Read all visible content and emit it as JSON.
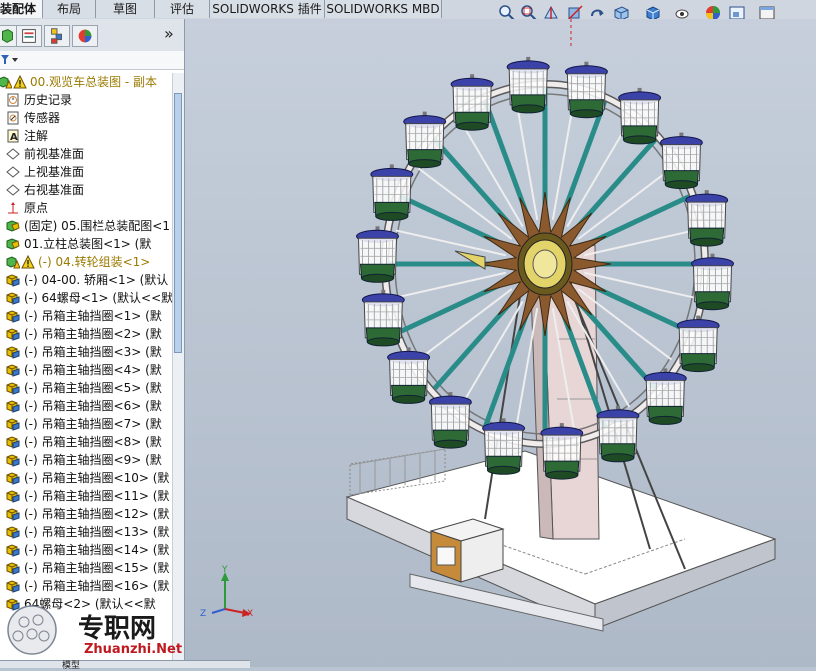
{
  "tabs": [
    {
      "label": "装配体",
      "active": true
    },
    {
      "label": "布局"
    },
    {
      "label": "草图"
    },
    {
      "label": "评估"
    },
    {
      "label": "SOLIDWORKS 插件"
    },
    {
      "label": "SOLIDWORKS MBD"
    }
  ],
  "view_toolbar_icons": [
    "zoom-to-fit-icon",
    "zoom-area-icon",
    "previous-view-icon",
    "section-view-icon",
    "dynamic-annotation-icon",
    "view-orientation-icon",
    "display-style-icon",
    "hide-show-icon",
    "appearance-icon",
    "scene-icon",
    "display-pane-icon"
  ],
  "panel": {
    "tab_icons": [
      "feature-manager-icon",
      "property-manager-icon",
      "configuration-manager-icon",
      "display-manager-icon"
    ],
    "expand_glyph": "»"
  },
  "tree": [
    {
      "label": "00.观览车总装图 - 副本",
      "icon": "assembly-warning-icon",
      "color": "#9a7a00"
    },
    {
      "label": "历史记录",
      "icon": "history-icon"
    },
    {
      "label": "传感器",
      "icon": "sensor-icon"
    },
    {
      "label": "注解",
      "icon": "annotation-icon"
    },
    {
      "label": "前视基准面",
      "icon": "plane-icon"
    },
    {
      "label": "上视基准面",
      "icon": "plane-icon"
    },
    {
      "label": "右视基准面",
      "icon": "plane-icon"
    },
    {
      "label": "原点",
      "icon": "origin-icon"
    },
    {
      "label": "(固定) 05.围栏总装配图<1",
      "icon": "subassembly-icon"
    },
    {
      "label": "01.立柱总装图<1> (默",
      "icon": "subassembly-icon"
    },
    {
      "label": "(-) 04.转轮组装<1>",
      "icon": "subassembly-warning-icon",
      "color": "#9a7a00"
    },
    {
      "label": "(-) 04-00. 轿厢<1> (默认",
      "icon": "part-icon"
    },
    {
      "label": "(-) 64螺母<1> (默认<<默",
      "icon": "part-icon"
    },
    {
      "label": "(-) 吊箱主轴挡圈<1> (默",
      "icon": "part-icon"
    },
    {
      "label": "(-) 吊箱主轴挡圈<2> (默",
      "icon": "part-icon"
    },
    {
      "label": "(-) 吊箱主轴挡圈<3> (默",
      "icon": "part-icon"
    },
    {
      "label": "(-) 吊箱主轴挡圈<4> (默",
      "icon": "part-icon"
    },
    {
      "label": "(-) 吊箱主轴挡圈<5> (默",
      "icon": "part-icon"
    },
    {
      "label": "(-) 吊箱主轴挡圈<6> (默",
      "icon": "part-icon"
    },
    {
      "label": "(-) 吊箱主轴挡圈<7> (默",
      "icon": "part-icon"
    },
    {
      "label": "(-) 吊箱主轴挡圈<8> (默",
      "icon": "part-icon"
    },
    {
      "label": "(-) 吊箱主轴挡圈<9> (默",
      "icon": "part-icon"
    },
    {
      "label": "(-) 吊箱主轴挡圈<10> (默",
      "icon": "part-icon"
    },
    {
      "label": "(-) 吊箱主轴挡圈<11> (默",
      "icon": "part-icon"
    },
    {
      "label": "(-) 吊箱主轴挡圈<12> (默",
      "icon": "part-icon"
    },
    {
      "label": "(-) 吊箱主轴挡圈<13> (默",
      "icon": "part-icon"
    },
    {
      "label": "(-) 吊箱主轴挡圈<14> (默",
      "icon": "part-icon"
    },
    {
      "label": "(-) 吊箱主轴挡圈<15> (默",
      "icon": "part-icon"
    },
    {
      "label": "(-) 吊箱主轴挡圈<16> (默",
      "icon": "part-icon"
    },
    {
      "label": "64螺母<2> (默认<<默",
      "icon": "part-icon"
    }
  ],
  "triad": {
    "x": "X",
    "y": "Y",
    "z": "Z"
  },
  "watermark": {
    "main": "专职网",
    "sub": "Zhuanzhi.Net"
  },
  "bottom_tab": "模型",
  "colors": {
    "accent_tab": "#f4f6f8",
    "warning": "#e8c000",
    "cabin_roof": "#3b43a8",
    "cabin_base": "#2e6a35",
    "spoke": "#2a8c88",
    "hub": "#e3d46a"
  }
}
